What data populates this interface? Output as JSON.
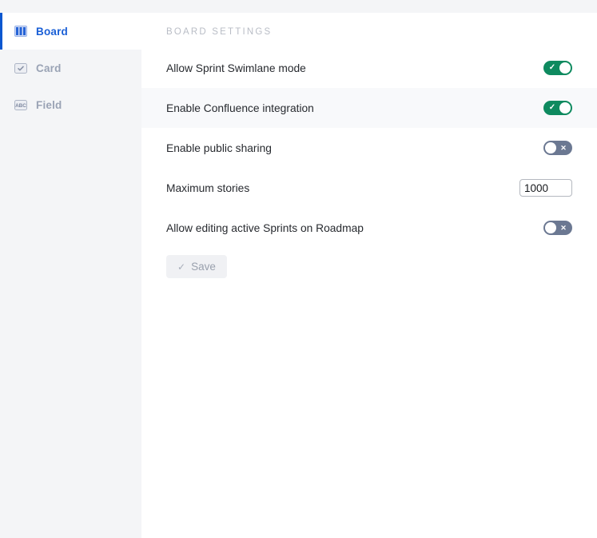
{
  "sidebar": {
    "items": [
      {
        "id": "board",
        "label": "Board",
        "icon": "board-columns-icon",
        "active": true
      },
      {
        "id": "card",
        "label": "Card",
        "icon": "card-check-icon",
        "active": false
      },
      {
        "id": "field",
        "label": "Field",
        "icon": "field-abc-icon",
        "active": false
      }
    ]
  },
  "main": {
    "section_title": "BOARD SETTINGS",
    "settings": [
      {
        "id": "allow-sprint-swimlane-mode",
        "label": "Allow Sprint Swimlane mode",
        "control": "toggle",
        "value": "on",
        "mark": "✓",
        "striped": false
      },
      {
        "id": "enable-confluence-integration",
        "label": "Enable Confluence integration",
        "control": "toggle",
        "value": "on",
        "mark": "✓",
        "striped": true
      },
      {
        "id": "enable-public-sharing",
        "label": "Enable public sharing",
        "control": "toggle",
        "value": "off",
        "mark": "✕",
        "striped": false
      },
      {
        "id": "maximum-stories",
        "label": "Maximum stories",
        "control": "number",
        "value": "1000",
        "striped": false
      },
      {
        "id": "allow-editing-active-sprints-on-roadmap",
        "label": "Allow editing active Sprints on Roadmap",
        "control": "toggle",
        "value": "off",
        "mark": "✕",
        "striped": false
      }
    ],
    "save": {
      "label": "Save",
      "check_icon": "✓",
      "disabled": true
    }
  },
  "colors": {
    "accent_blue": "#1a5fd6",
    "active_border": "#0b57d0",
    "toggle_on": "#0e8a5f",
    "toggle_off": "#6b7892",
    "sidebar_bg": "#f4f5f7",
    "row_stripe": "#f8f9fb",
    "label_text": "#272a2f",
    "muted_text": "#9aa3b5",
    "section_title": "#b9bdc6"
  }
}
